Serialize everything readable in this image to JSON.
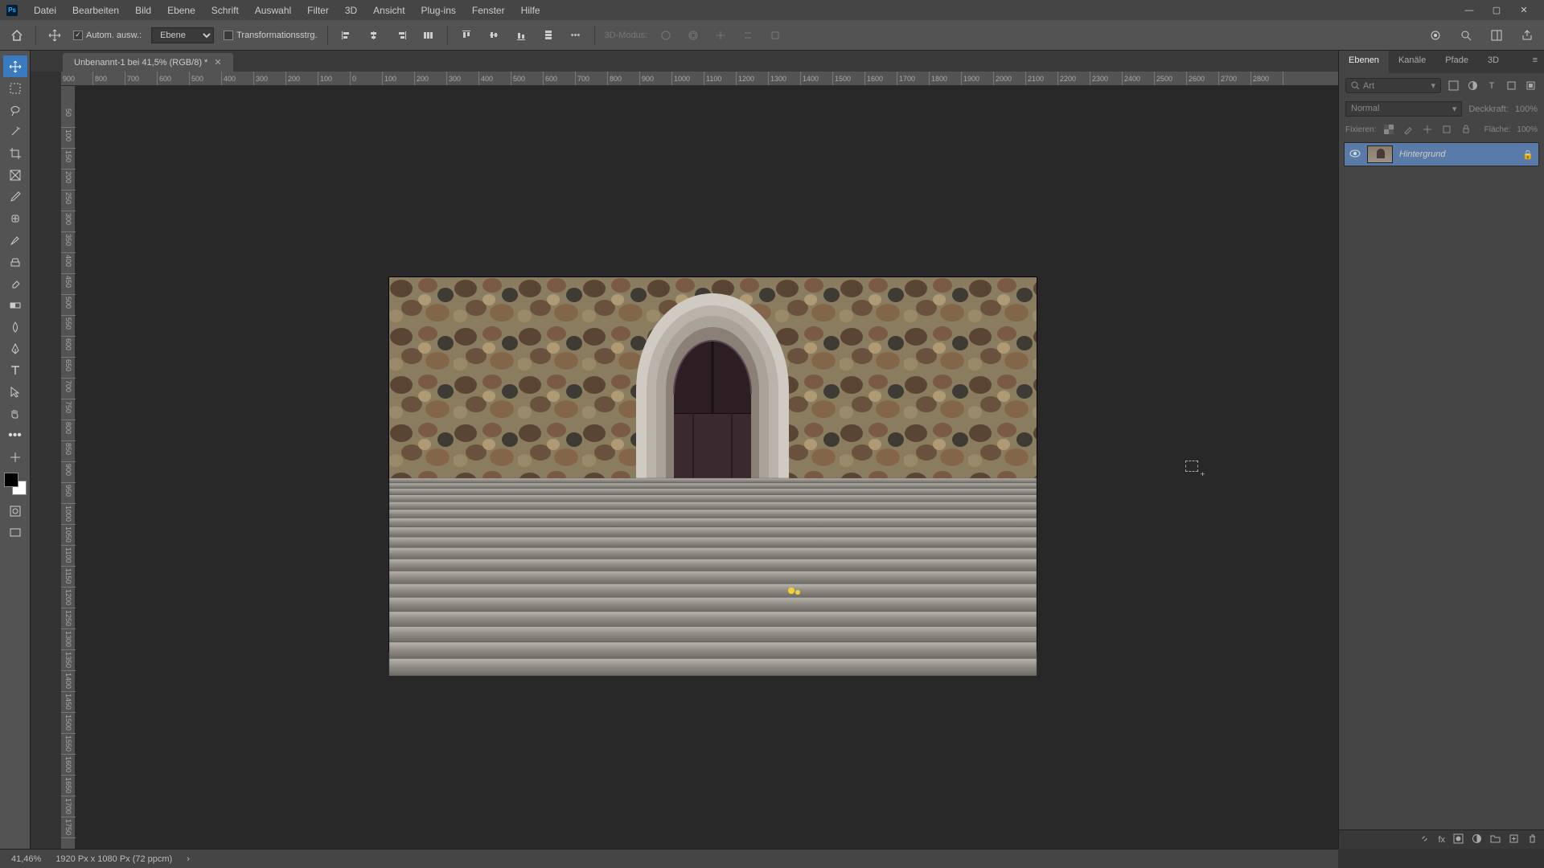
{
  "app": {
    "logo_text": "Ps"
  },
  "menu": {
    "items": [
      "Datei",
      "Bearbeiten",
      "Bild",
      "Ebene",
      "Schrift",
      "Auswahl",
      "Filter",
      "3D",
      "Ansicht",
      "Plug-ins",
      "Fenster",
      "Hilfe"
    ]
  },
  "optionbar": {
    "auto_select_label": "Autom. ausw.:",
    "auto_select_value": "Ebene",
    "transform_label": "Transformationsstrg.",
    "mode_3d_label": "3D-Modus:"
  },
  "tab": {
    "title": "Unbenannt-1 bei 41,5% (RGB/8) *"
  },
  "ruler_h": [
    "900",
    "800",
    "700",
    "600",
    "500",
    "400",
    "300",
    "200",
    "100",
    "0",
    "100",
    "200",
    "300",
    "400",
    "500",
    "600",
    "700",
    "800",
    "900",
    "1000",
    "1100",
    "1200",
    "1300",
    "1400",
    "1500",
    "1600",
    "1700",
    "1800",
    "1900",
    "2000",
    "2100",
    "2200",
    "2300",
    "2400",
    "2500",
    "2600",
    "2700",
    "2800"
  ],
  "ruler_v": [
    "",
    "50",
    "100",
    "150",
    "200",
    "250",
    "300",
    "350",
    "400",
    "450",
    "500",
    "550",
    "600",
    "650",
    "700",
    "750",
    "800",
    "850",
    "900",
    "950",
    "1000",
    "1050",
    "1100",
    "1150",
    "1200",
    "1250",
    "1300",
    "1350",
    "1400",
    "1450",
    "1500",
    "1550",
    "1600",
    "1650",
    "1700",
    "1750"
  ],
  "layers_panel": {
    "tabs": [
      "Ebenen",
      "Kanäle",
      "Pfade",
      "3D"
    ],
    "search_placeholder": "Art",
    "blend_mode": "Normal",
    "opacity_label": "Deckkraft:",
    "opacity_value": "100%",
    "lock_label": "Fixieren:",
    "fill_label": "Fläche:",
    "fill_value": "100%",
    "layer_name": "Hintergrund"
  },
  "status": {
    "zoom": "41,46%",
    "doc": "1920 Px x 1080 Px (72 ppcm)"
  }
}
